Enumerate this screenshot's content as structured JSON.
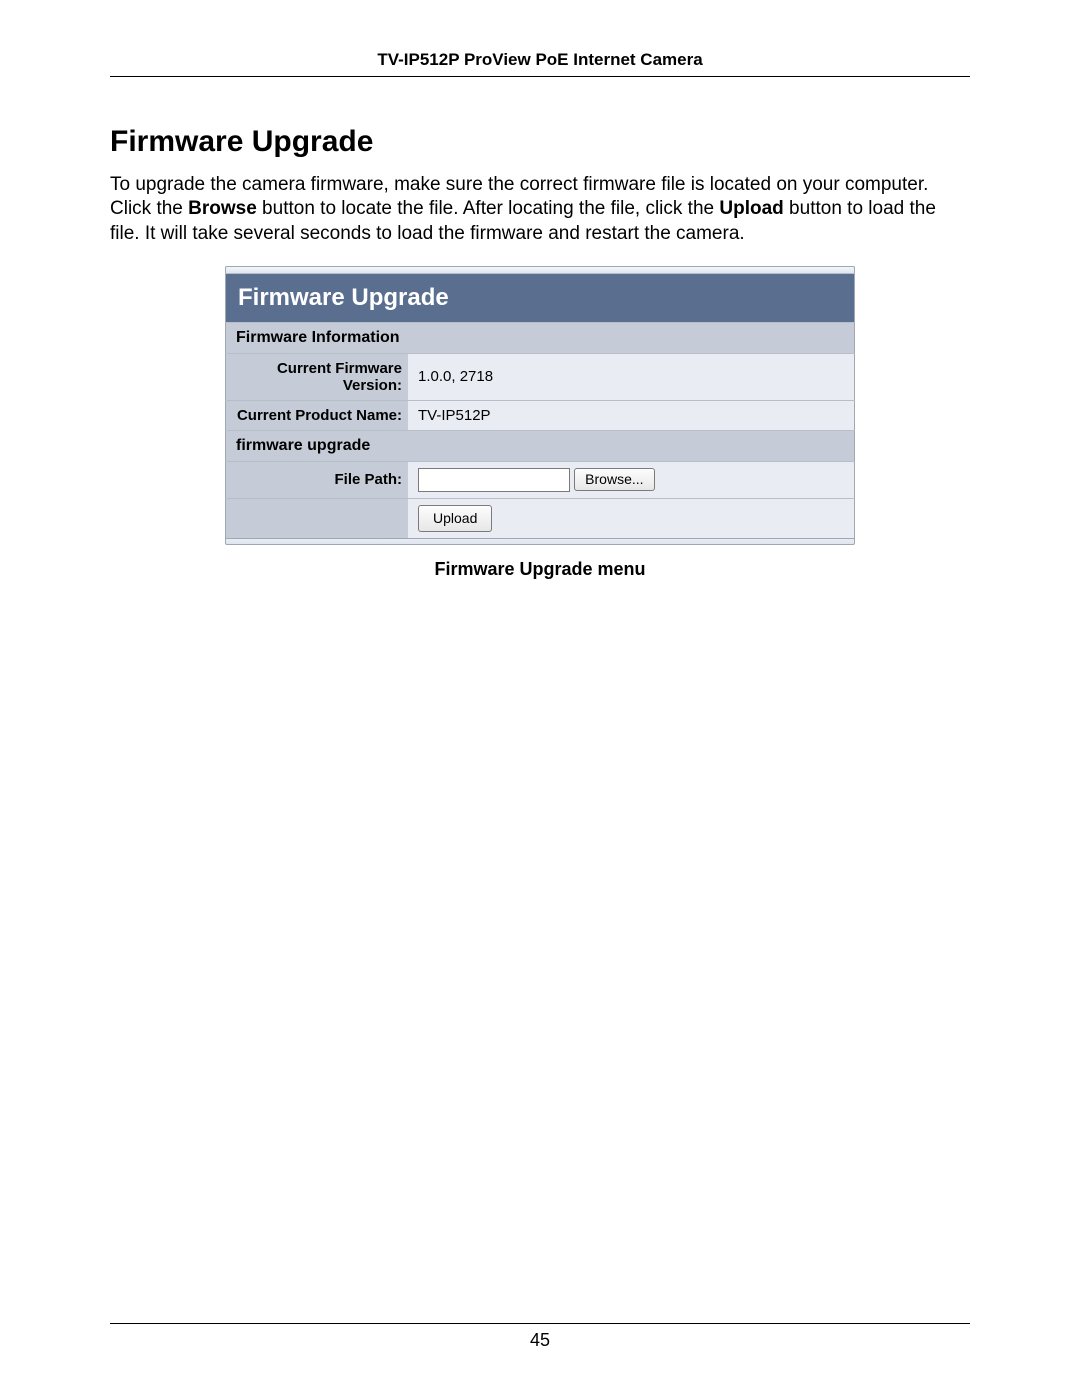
{
  "header": {
    "running_title": "TV-IP512P ProView PoE Internet Camera"
  },
  "section": {
    "heading": "Firmware Upgrade",
    "para_a": "To upgrade the camera firmware, make sure the correct firmware file is located on your computer. Click the ",
    "para_b_bold": "Browse",
    "para_c": " button to locate the file. After locating the file, click the ",
    "para_d_bold": "Upload",
    "para_e": " button to load the file. It will take several seconds to load the firmware and restart the camera."
  },
  "panel": {
    "title": "Firmware Upgrade",
    "info_section": "Firmware Information",
    "rows": {
      "version_label": "Current Firmware Version:",
      "version_value": "1.0.0, 2718",
      "product_label": "Current Product Name:",
      "product_value": "TV-IP512P"
    },
    "upgrade_section": "firmware upgrade",
    "file_path_label": "File Path:",
    "browse_button": "Browse...",
    "upload_button": "Upload"
  },
  "caption": "Firmware Upgrade menu",
  "footer": {
    "page_number": "45"
  }
}
